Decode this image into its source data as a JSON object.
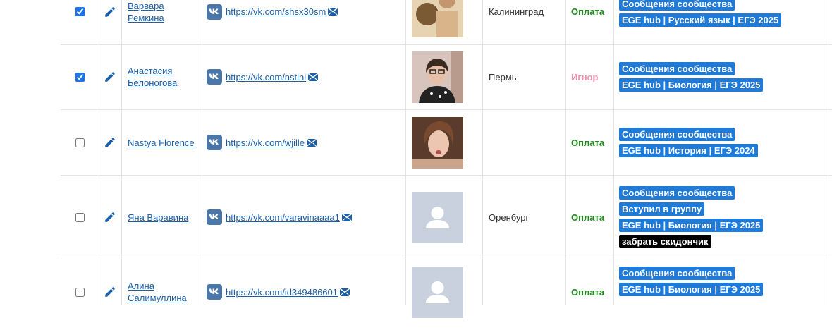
{
  "rows": [
    {
      "checked": true,
      "name": "Варвара Ремкина",
      "vk_url": "https://vk.com/shsx30sm",
      "city": "Калининград",
      "status": "Оплата",
      "tags": [
        "Сообщения сообщества",
        "EGE hub | Русский язык | ЕГЭ 2025"
      ]
    },
    {
      "checked": true,
      "name": "Анастасия Белоногова",
      "vk_url": "https://vk.com/nstini",
      "city": "Пермь",
      "status": "Игнор",
      "tags": [
        "Сообщения сообщества",
        "EGE hub | Биология | ЕГЭ 2025"
      ]
    },
    {
      "checked": false,
      "name": "Nastya Florence",
      "vk_url": "https://vk.com/wjille",
      "city": "",
      "status": "Оплата",
      "tags": [
        "Сообщения сообщества",
        "EGE hub | История | ЕГЭ 2024"
      ]
    },
    {
      "checked": false,
      "name": "Яна Варавина",
      "vk_url": "https://vk.com/varavinaaaa1",
      "city": "Оренбург",
      "status": "Оплата",
      "tags": [
        "Сообщения сообщества",
        "Вступил в группу",
        "EGE hub | Биология | ЕГЭ 2025",
        "забрать скидончик"
      ]
    },
    {
      "checked": false,
      "name": "Алина Салимуллина",
      "vk_url": "https://vk.com/id349486601",
      "city": "",
      "status": "Оплата",
      "tags": [
        "Сообщения сообщества",
        "EGE hub | Биология | ЕГЭ 2025"
      ]
    }
  ],
  "icons": {
    "edit": "pencil-icon",
    "vk": "vk-logo-icon",
    "mail": "envelope-icon",
    "avatar_placeholder": "user-placeholder-icon"
  },
  "colors": {
    "link": "#1a5fa8",
    "tag_blue": "#1f7ad8",
    "tag_black": "#000000",
    "status_pay": "#1e8a1e",
    "status_ignore": "#f08fb0",
    "vk_blue": "#4a76a8"
  }
}
